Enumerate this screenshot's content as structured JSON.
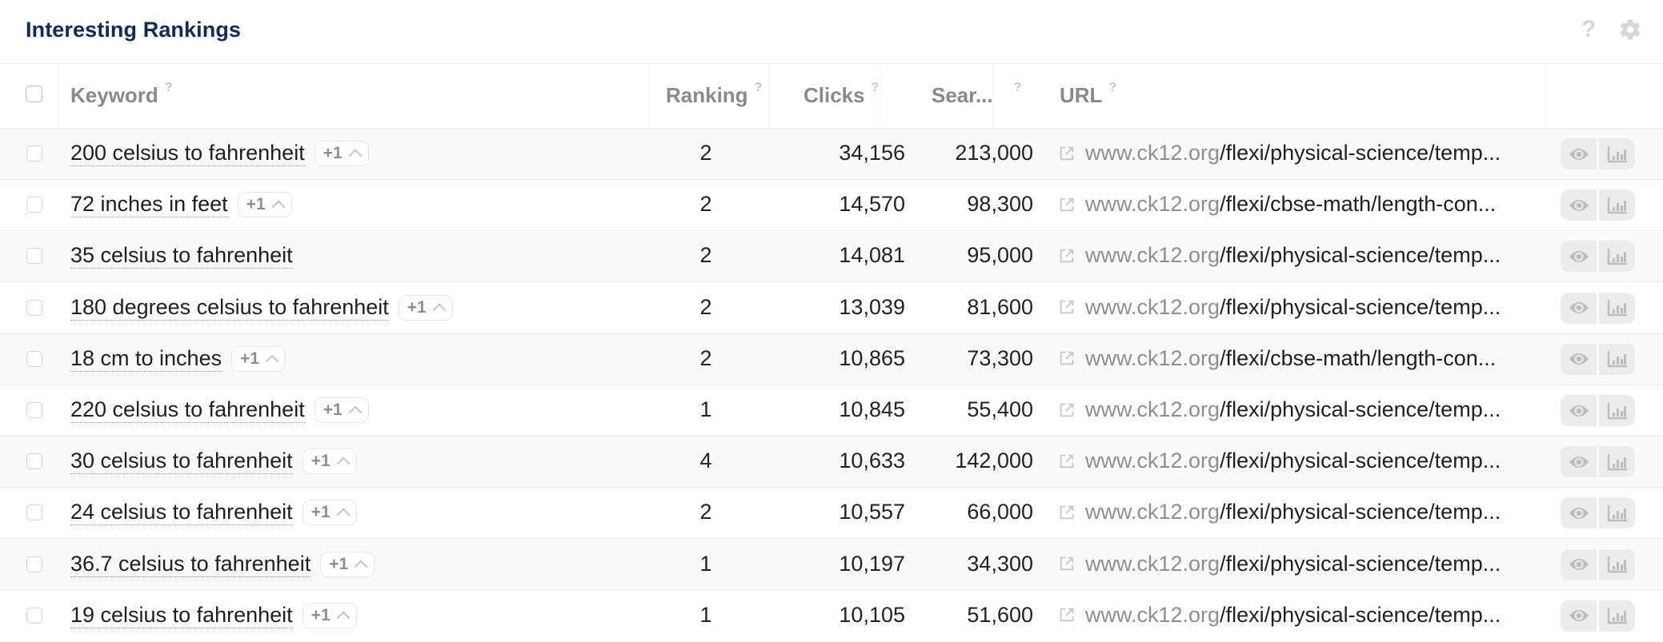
{
  "card": {
    "title": "Interesting Rankings",
    "help_icon": "?",
    "settings_icon": "gear-icon"
  },
  "columns": {
    "keyword": "Keyword",
    "ranking": "Ranking",
    "clicks": "Clicks",
    "search": "Sear...",
    "url": "URL",
    "help_marker": "?"
  },
  "rows": [
    {
      "keyword": "200 celsius to fahrenheit",
      "badge": "+1",
      "ranking": "2",
      "clicks": "34,156",
      "search": "213,000",
      "domain": "www.ck12.org",
      "path": "/flexi/physical-science/temp..."
    },
    {
      "keyword": "72 inches in feet",
      "badge": "+1",
      "ranking": "2",
      "clicks": "14,570",
      "search": "98,300",
      "domain": "www.ck12.org",
      "path": "/flexi/cbse-math/length-con..."
    },
    {
      "keyword": "35 celsius to fahrenheit",
      "badge": null,
      "ranking": "2",
      "clicks": "14,081",
      "search": "95,000",
      "domain": "www.ck12.org",
      "path": "/flexi/physical-science/temp..."
    },
    {
      "keyword": "180 degrees celsius to fahrenheit",
      "badge": "+1",
      "ranking": "2",
      "clicks": "13,039",
      "search": "81,600",
      "domain": "www.ck12.org",
      "path": "/flexi/physical-science/temp..."
    },
    {
      "keyword": "18 cm to inches",
      "badge": "+1",
      "ranking": "2",
      "clicks": "10,865",
      "search": "73,300",
      "domain": "www.ck12.org",
      "path": "/flexi/cbse-math/length-con..."
    },
    {
      "keyword": "220 celsius to fahrenheit",
      "badge": "+1",
      "ranking": "1",
      "clicks": "10,845",
      "search": "55,400",
      "domain": "www.ck12.org",
      "path": "/flexi/physical-science/temp..."
    },
    {
      "keyword": "30 celsius to fahrenheit",
      "badge": "+1",
      "ranking": "4",
      "clicks": "10,633",
      "search": "142,000",
      "domain": "www.ck12.org",
      "path": "/flexi/physical-science/temp..."
    },
    {
      "keyword": "24 celsius to fahrenheit",
      "badge": "+1",
      "ranking": "2",
      "clicks": "10,557",
      "search": "66,000",
      "domain": "www.ck12.org",
      "path": "/flexi/physical-science/temp..."
    },
    {
      "keyword": "36.7 celsius to fahrenheit",
      "badge": "+1",
      "ranking": "1",
      "clicks": "10,197",
      "search": "34,300",
      "domain": "www.ck12.org",
      "path": "/flexi/physical-science/temp..."
    },
    {
      "keyword": "19 celsius to fahrenheit",
      "badge": "+1",
      "ranking": "1",
      "clicks": "10,105",
      "search": "51,600",
      "domain": "www.ck12.org",
      "path": "/flexi/physical-science/temp..."
    }
  ],
  "colors": {
    "title": "#0d2b5e",
    "header_text": "#8a8a8a",
    "row_alt_bg": "#fafafa",
    "domain_text": "#8e8e8e"
  }
}
